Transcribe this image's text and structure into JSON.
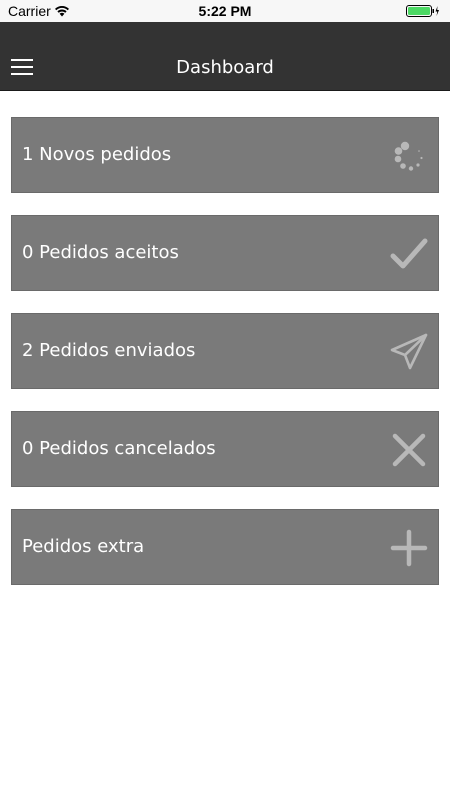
{
  "status_bar": {
    "carrier": "Carrier",
    "time": "5:22 PM",
    "wifi_icon": "wifi-icon",
    "battery_icon": "battery-charging-icon",
    "battery_color": "#4cd964"
  },
  "navbar": {
    "title": "Dashboard",
    "menu_icon": "hamburger-menu-icon",
    "background": "#333333"
  },
  "cards": [
    {
      "label": "1 Novos pedidos",
      "icon": "loading-spinner-icon"
    },
    {
      "label": "0 Pedidos aceitos",
      "icon": "checkmark-icon"
    },
    {
      "label": "2 Pedidos enviados",
      "icon": "paper-plane-icon"
    },
    {
      "label": "0 Pedidos cancelados",
      "icon": "close-x-icon"
    },
    {
      "label": "Pedidos extra",
      "icon": "plus-icon"
    }
  ],
  "colors": {
    "card_background": "#7a7a7a",
    "icon_color": "#b8b8b8",
    "text_color": "#ffffff"
  }
}
